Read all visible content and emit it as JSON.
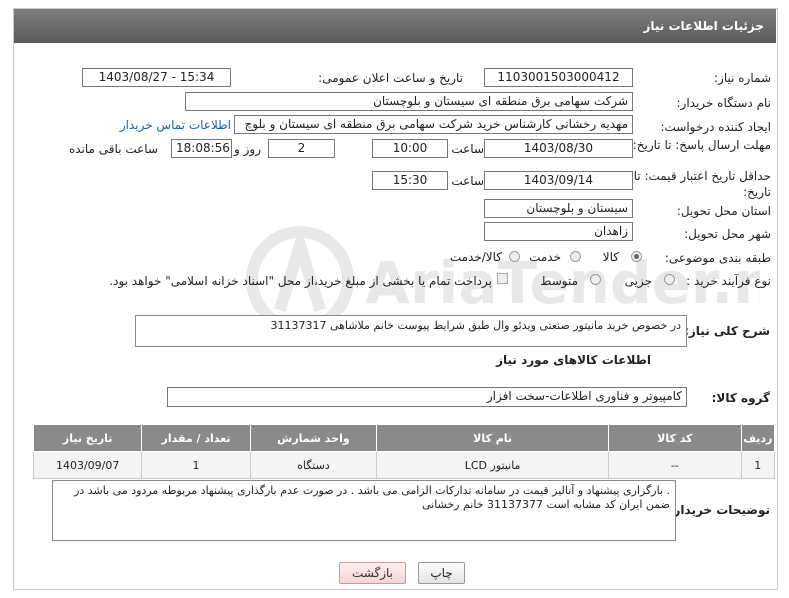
{
  "header": {
    "title": "جزئیات اطلاعات نیاز"
  },
  "fields": {
    "need_number_label": "شماره نیاز:",
    "need_number": "1103001503000412",
    "announce_label": "تاریخ و ساعت اعلان عمومی:",
    "announce_value": "1403/08/27 - 15:34",
    "buyer_org_label": "نام دستگاه خریدار:",
    "buyer_org": "شرکت سهامی برق منطقه ای سیستان و بلوچستان",
    "creator_label": "ایجاد کننده درخواست:",
    "creator": "مهدیه رخشانی کارشناس خرید شرکت سهامی برق منطقه ای سیستان و بلوچ",
    "contact_link": "اطلاعات تماس خریدار",
    "deadline_label": "مهلت ارسال پاسخ: تا تاریخ:",
    "deadline_date": "1403/08/30",
    "time_label": "ساعت",
    "deadline_time": "10:00",
    "days_value": "2",
    "days_label": "روز و",
    "remaining_time": "18:08:56",
    "remaining_label": "ساعت باقی مانده",
    "validity_label": "حداقل تاریخ اعتبار قیمت: تا تاریخ:",
    "validity_date": "1403/09/14",
    "validity_time": "15:30",
    "province_label": "استان محل تحویل:",
    "province": "سیستان و بلوچستان",
    "city_label": "شهر محل تحویل:",
    "city": "زاهدان",
    "category_label": "طبقه بندی موضوعی:",
    "category_options": [
      "کالا",
      "خدمت",
      "کالا/خدمت"
    ],
    "process_label": "نوع فرآیند خرید :",
    "process_options": [
      "جزیی",
      "متوسط"
    ],
    "payment_note": "پرداخت تمام یا بخشی از مبلغ خرید،از محل \"اسناد خزانه اسلامی\" خواهد بود."
  },
  "description": {
    "label": "شرح کلی نیاز:",
    "text": "در خصوص خرید مانیتور صنعتی ویدئو وال طبق شرایط پیوست خانم ملاشاهی 31137317"
  },
  "goods_section": {
    "title": "اطلاعات کالاهای مورد نیاز",
    "group_label": "گروه کالا:",
    "group_value": "کامپیوتر و فناوری اطلاعات-سخت افزار"
  },
  "table": {
    "headers": [
      "ردیف",
      "کد کالا",
      "نام کالا",
      "واحد شمارش",
      "تعداد / مقدار",
      "تاریخ نیاز"
    ],
    "rows": [
      [
        "1",
        "--",
        "مانیتور LCD",
        "دستگاه",
        "1",
        "1403/09/07"
      ]
    ]
  },
  "buyer_notes": {
    "label": "توضیحات خریدار:",
    "text": ". بارگزاری پیشنهاد و آنالیز قیمت در سامانه تدارکات الزامی می باشد . در صورت عدم بارگذاری پیشنهاد مربوطه مردود می باشد در ضمن ایران کد مشابه است 31137377 خانم رخشانی"
  },
  "buttons": {
    "print": "چاپ",
    "back": "بازگشت"
  },
  "watermark": "AriaTender.net"
}
